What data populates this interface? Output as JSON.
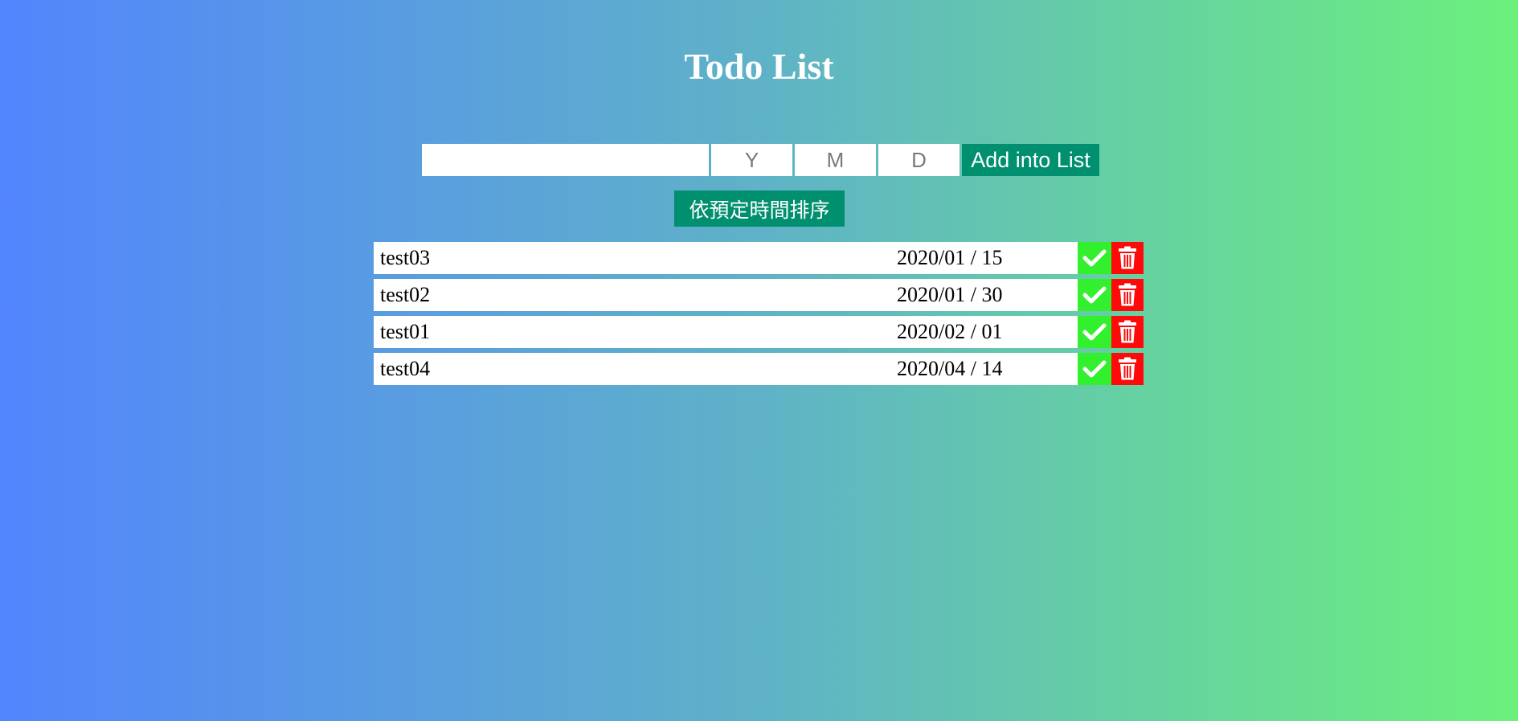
{
  "header": {
    "title": "Todo List"
  },
  "form": {
    "todo_placeholder": "",
    "year_placeholder": "Y",
    "month_placeholder": "M",
    "day_placeholder": "D",
    "add_label": "Add into List"
  },
  "sort": {
    "label": "依預定時間排序"
  },
  "todos": [
    {
      "name": "test03",
      "date": "2020/01 / 15"
    },
    {
      "name": "test02",
      "date": "2020/01 / 30"
    },
    {
      "name": "test01",
      "date": "2020/02 / 01"
    },
    {
      "name": "test04",
      "date": "2020/04 / 14"
    }
  ],
  "icons": {
    "done": "check-icon",
    "delete": "trash-icon"
  },
  "colors": {
    "gradient_start": "#5285fd",
    "gradient_end": "#6cf07c",
    "button_teal": "#008f6f",
    "done_green": "#33f02f",
    "delete_red": "#ff0a0a"
  }
}
